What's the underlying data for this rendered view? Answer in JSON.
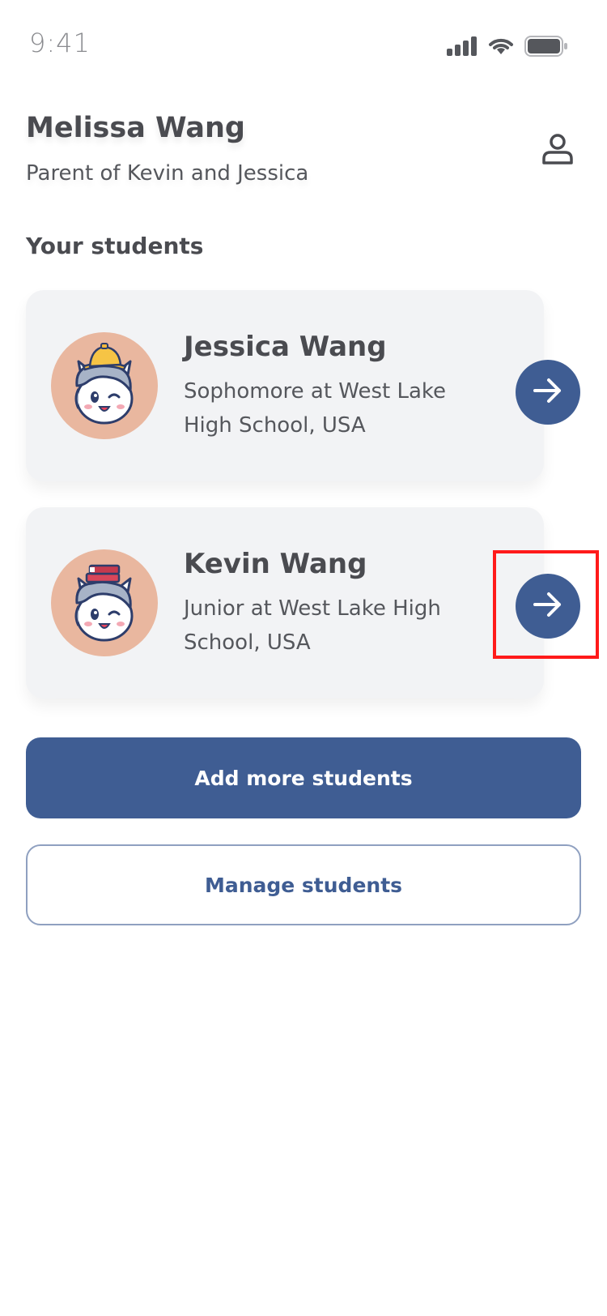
{
  "status_bar": {
    "time": "9:41",
    "icons": [
      "cellular-signal-icon",
      "wifi-icon",
      "battery-icon"
    ]
  },
  "header": {
    "name": "Melissa Wang",
    "subtitle": "Parent of Kevin and Jessica",
    "profile_icon": "person-icon"
  },
  "section": {
    "title": "Your students"
  },
  "students": [
    {
      "name": "Jessica Wang",
      "description": "Sophomore at West Lake High School, USA",
      "avatar": "unicorn-hat-avatar",
      "action_icon": "arrow-right-icon"
    },
    {
      "name": "Kevin Wang",
      "description": "Junior at West Lake High School, USA",
      "avatar": "unicorn-books-avatar",
      "action_icon": "arrow-right-icon"
    }
  ],
  "actions": {
    "add_label": "Add more students",
    "manage_label": "Manage students"
  },
  "colors": {
    "primary": "#3f5d93",
    "card_bg": "#f2f3f5",
    "avatar_bg": "#e9b79f",
    "highlight": "#ff1a1a"
  }
}
